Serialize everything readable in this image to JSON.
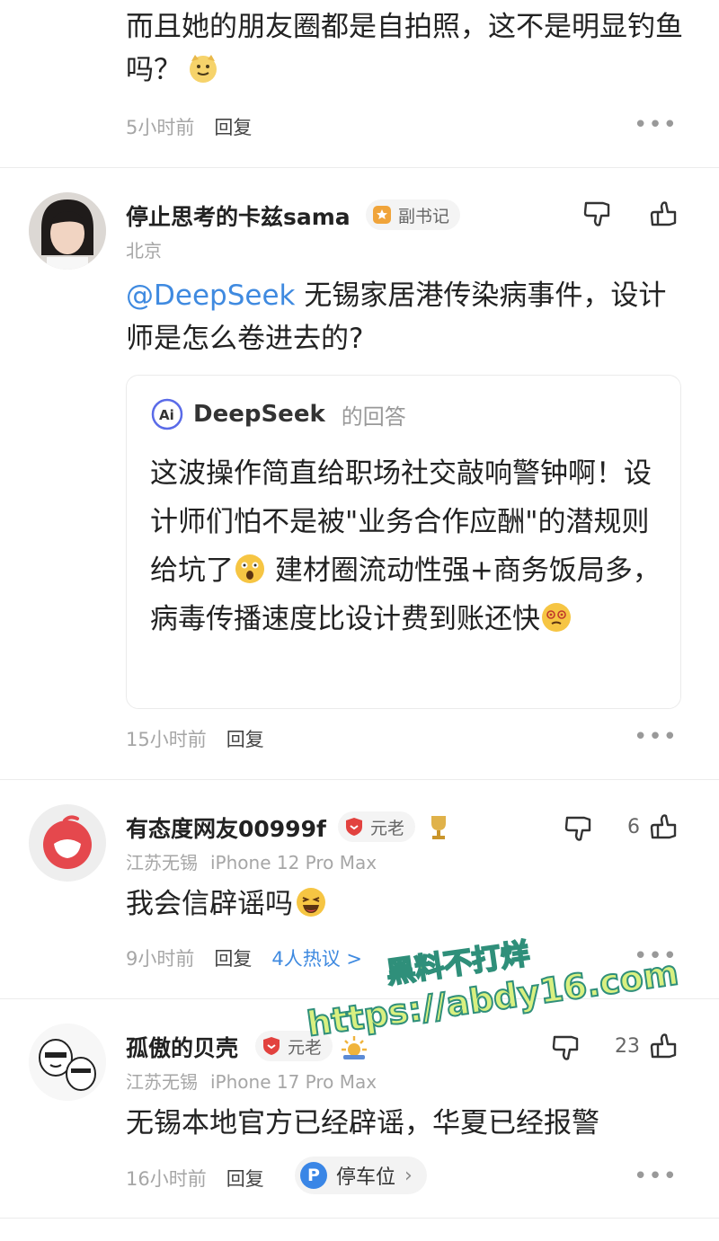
{
  "top_comment": {
    "text": "而且她的朋友圈都是自拍照，这不是明显钓鱼吗？",
    "time": "5小时前",
    "reply_label": "回复",
    "more_label": "•••"
  },
  "comments": [
    {
      "username": "停止思考的卡兹sama",
      "badge": "副书记",
      "location": "北京",
      "device": "",
      "mention": "@DeepSeek",
      "text": " 无锡家居港传染病事件，设计师是怎么卷进去的?",
      "ai_reply": {
        "name": "DeepSeek",
        "suffix": "的回答",
        "text_part1": "这波操作简直给职场社交敲响警钟啊！设计师们怕不是被\"业务合作应酬\"的潜规则给坑了",
        "text_part2": "建材圈流动性强+商务饭局多，病毒传播速度比设计费到账还快"
      },
      "time": "15小时前",
      "reply_label": "回复",
      "likes": "",
      "more_label": "•••"
    },
    {
      "username": "有态度网友00999f",
      "badge": "元老",
      "location": "江苏无锡",
      "device": "iPhone 12 Pro Max",
      "text": "我会信辟谣吗",
      "time": "9小时前",
      "reply_label": "回复",
      "hot_label": "4人热议 >",
      "likes": "6",
      "more_label": "•••"
    },
    {
      "username": "孤傲的贝壳",
      "badge": "元老",
      "location": "江苏无锡",
      "device": "iPhone 17 Pro Max",
      "text": "无锡本地官方已经辟谣，华夏已经报警",
      "time": "16小时前",
      "reply_label": "回复",
      "tag_label": "停车位",
      "tag_icon": "P",
      "likes": "23",
      "more_label": "•••"
    }
  ],
  "watermark": {
    "line1": "黑料不打烊",
    "line2": "https://abdy16.com"
  },
  "colors": {
    "link_blue": "#3f8ae0",
    "meta_gray": "#a6a6a6",
    "watermark_fill": "#d9f080",
    "watermark_stroke": "#2f8f7a"
  }
}
